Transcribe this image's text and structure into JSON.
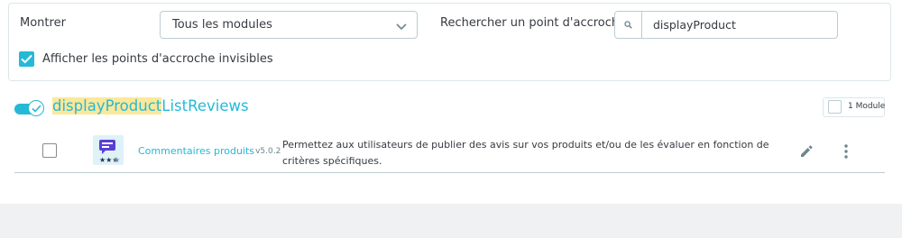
{
  "filters": {
    "show_label": "Montrer",
    "modules_select": "Tous les modules",
    "search_label": "Rechercher un point d'accroche",
    "search_value": "displayProduct",
    "invisible_checkbox_label": "Afficher les points d'accroche invisibles",
    "invisible_checked": true
  },
  "hook": {
    "name_highlight": "displayProduct",
    "name_rest": "ListReviews",
    "enabled": true,
    "module_count_label": "1 Module"
  },
  "modules": [
    {
      "name": "Commentaires produits",
      "version": "- v5.0.2",
      "description": "Permettez aux utilisateurs de publier des avis sur vos produits et/ou de les évaluer en fonction de critères spécifiques.",
      "icon": "product-comments-icon"
    }
  ],
  "colors": {
    "accent": "#25b9d7",
    "highlight": "#fbe89a",
    "border": "#bbcdd2",
    "footer_band": "#eff1f2"
  }
}
